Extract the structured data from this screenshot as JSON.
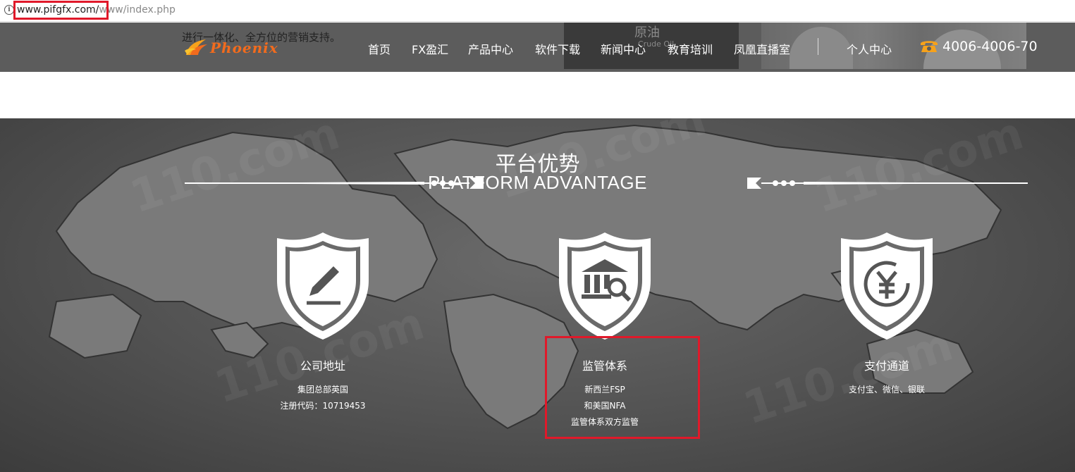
{
  "address_bar": {
    "url_highlighted": "www.pifgfx.com/",
    "url_rest": "www/index.php"
  },
  "header": {
    "tagline": "进行一体化、全方位的营销支持。",
    "logo_text": "Phoenix",
    "banner_text": "原油",
    "banner_sub": "Crude Oil",
    "nav": [
      "首页",
      "FX盈汇",
      "产品中心",
      "软件下载",
      "新闻中心",
      "教育培训",
      "凤凰直播室"
    ],
    "user_center": "个人中心",
    "phone": "4006-4006-70"
  },
  "section": {
    "title_cn": "平台优势",
    "title_en": "PLATFORM ADVANTAGE",
    "features": [
      {
        "icon": "pencil-icon",
        "title": "公司地址",
        "lines": [
          "集团总部英国",
          "注册代码：10719453"
        ]
      },
      {
        "icon": "bank-search-icon",
        "title": "监管体系",
        "lines": [
          "新西兰FSP",
          "和美国NFA",
          "监管体系双方监管"
        ]
      },
      {
        "icon": "yen-icon",
        "title": "支付通道",
        "lines": [
          "支付宝、微信、银联"
        ]
      }
    ]
  },
  "colors": {
    "header_bg": "#5c5c5c",
    "accent_orange": "#f26b1d",
    "highlight_red": "#e0192a"
  }
}
